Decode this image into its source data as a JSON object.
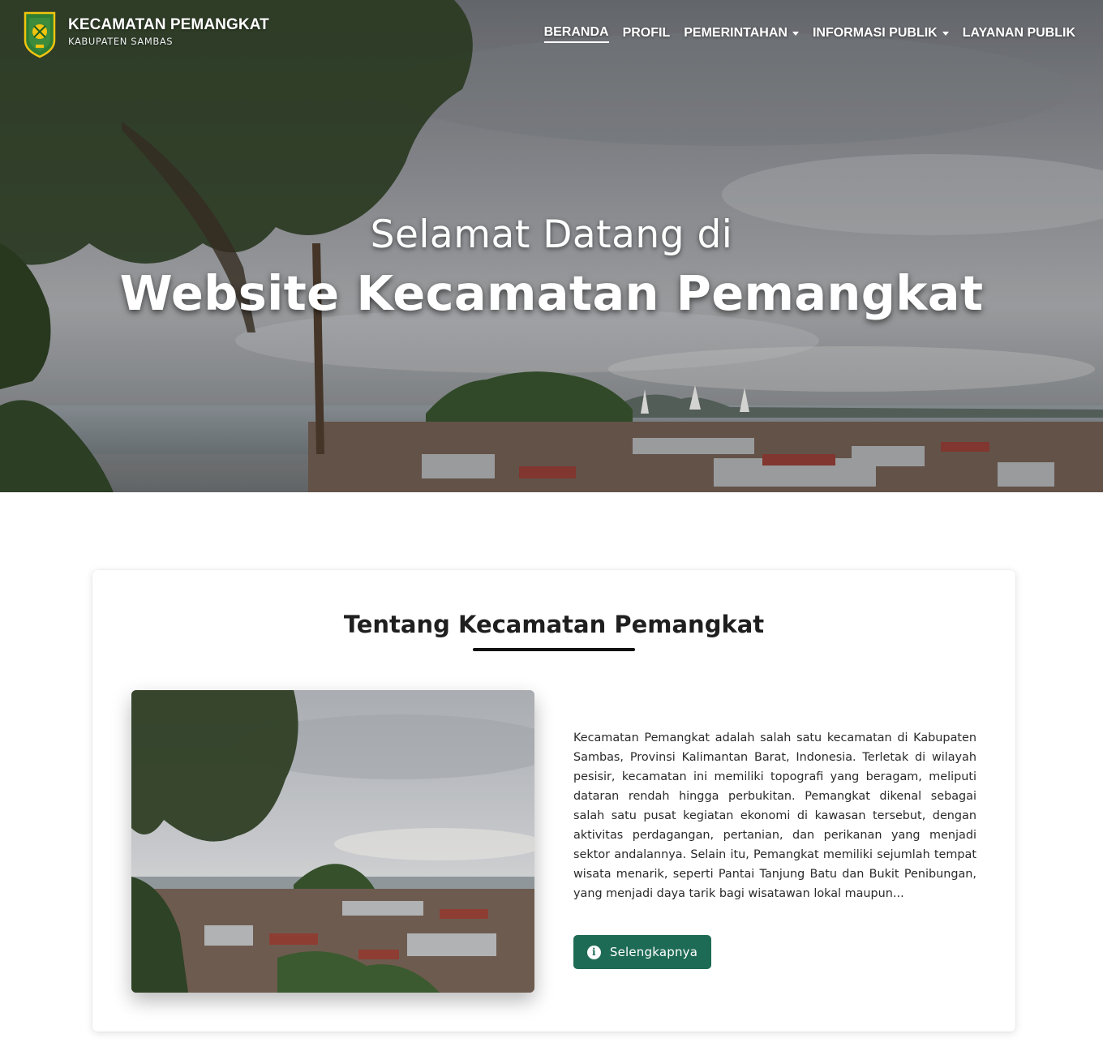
{
  "brand": {
    "title": "KECAMATAN PEMANGKAT",
    "subtitle": "KABUPATEN SAMBAS",
    "logo_icon": "kabupaten-sambas-emblem"
  },
  "nav": {
    "items": [
      {
        "label": "BERANDA",
        "active": true,
        "dropdown": false
      },
      {
        "label": "PROFIL",
        "active": false,
        "dropdown": false
      },
      {
        "label": "PEMERINTAHAN",
        "active": false,
        "dropdown": true
      },
      {
        "label": "INFORMASI PUBLIK",
        "active": false,
        "dropdown": true
      },
      {
        "label": "LAYANAN PUBLIK",
        "active": false,
        "dropdown": false
      }
    ]
  },
  "hero": {
    "subtitle": "Selamat Datang di",
    "title": "Website Kecamatan Pemangkat"
  },
  "about": {
    "heading": "Tentang Kecamatan Pemangkat",
    "body": "Kecamatan Pemangkat adalah salah satu kecamatan di Kabupaten Sambas, Provinsi Kalimantan Barat, Indonesia. Terletak di wilayah pesisir, kecamatan ini memiliki topografi yang beragam, meliputi dataran rendah hingga perbukitan. Pemangkat dikenal sebagai salah satu pusat kegiatan ekonomi di kawasan tersebut, dengan aktivitas perdagangan, pertanian, dan perikanan yang menjadi sektor andalannya. Selain itu, Pemangkat memiliki sejumlah tempat wisata menarik, seperti Pantai Tanjung Batu dan Bukit Penibungan, yang menjadi daya tarik bagi wisatawan lokal maupun...",
    "button_label": "Selengkapnya",
    "button_icon": "info-circle-icon"
  },
  "colors": {
    "accent_button": "#1e6b55",
    "hero_text": "#ffffff",
    "heading": "#1f1f1f"
  }
}
